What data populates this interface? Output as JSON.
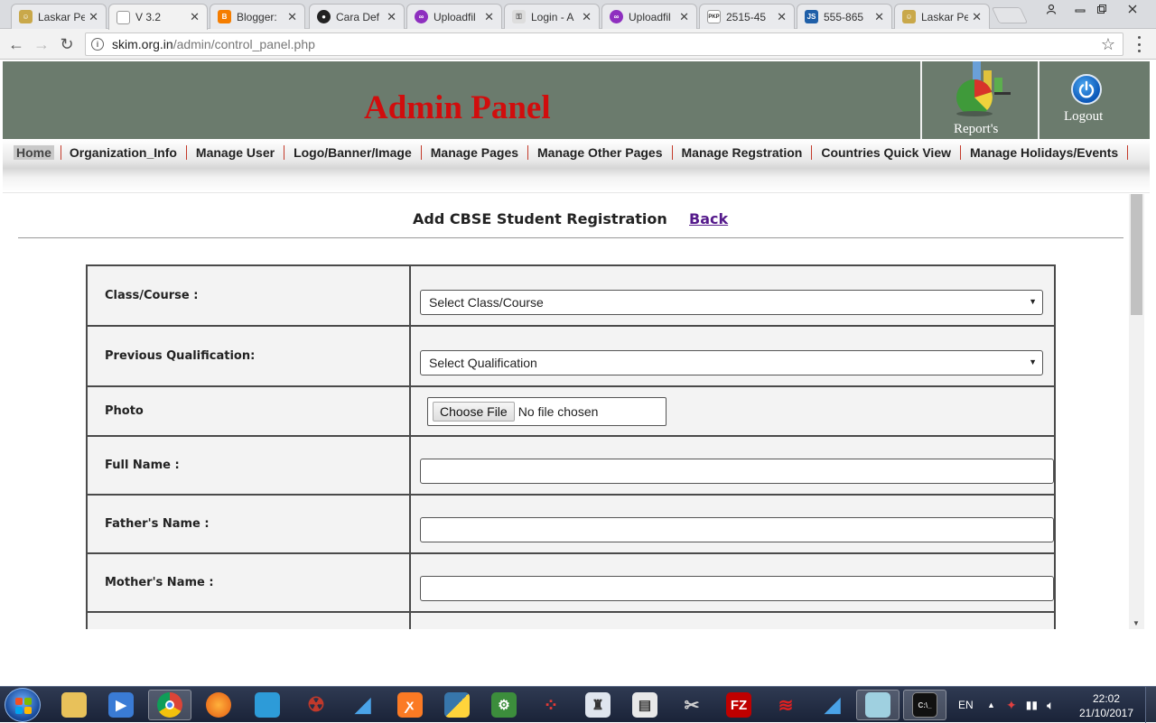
{
  "browser": {
    "tabs": [
      {
        "label": "Laskar Pe",
        "icon": "smiley-icon",
        "color": "#c9a84a"
      },
      {
        "label": "V 3.2",
        "icon": "document-icon",
        "color": "#9a9a9a"
      },
      {
        "label": "Blogger:",
        "icon": "blogger-icon",
        "color": "#f57d00"
      },
      {
        "label": "Cara Def",
        "icon": "github-icon",
        "color": "#222222"
      },
      {
        "label": "Uploadfil",
        "icon": "infinity-icon",
        "color": "#8e2fbf"
      },
      {
        "label": "Login - A",
        "icon": "key-icon",
        "color": "#777777"
      },
      {
        "label": "Uploadfil",
        "icon": "infinity-icon",
        "color": "#8e2fbf"
      },
      {
        "label": "2515-45",
        "icon": "pkp-icon",
        "color": "#555555"
      },
      {
        "label": "555-865",
        "icon": "js-icon",
        "color": "#1f5fa8"
      },
      {
        "label": "Laskar Pe",
        "icon": "smiley-icon",
        "color": "#c9a84a"
      }
    ],
    "close_glyph": "✕",
    "url_host": "skim.org.in",
    "url_path": "/admin/control_panel.php",
    "info_glyph": "i",
    "star_glyph": "☆",
    "back_glyph": "←",
    "forward_glyph": "→",
    "reload_glyph": "↻"
  },
  "header": {
    "title": "Admin Panel",
    "report_label": "Report's",
    "logout_label": "Logout"
  },
  "menu": {
    "items": [
      "Home",
      "Organization_Info",
      "Manage User",
      "Logo/Banner/Image",
      "Manage Pages",
      "Manage Other Pages",
      "Manage Regstration",
      "Countries Quick View",
      "Manage Holidays/Events"
    ]
  },
  "form": {
    "title": "Add CBSE Student Registration",
    "back_link": "Back",
    "class_label": "Class/Course :",
    "class_select": "Select Class/Course",
    "qual_label": "Previous Qualification:",
    "qual_select": "Select Qualification",
    "photo_label": "Photo",
    "file_button": "Choose File",
    "file_status": "No file chosen",
    "fullname_label": "Full Name :",
    "fullname_value": "",
    "father_label": "Father's Name :",
    "father_value": "",
    "mother_label": "Mother's Name :",
    "mother_value": ""
  },
  "taskbar": {
    "language": "EN",
    "time": "22:02",
    "date": "21/10/2017"
  }
}
